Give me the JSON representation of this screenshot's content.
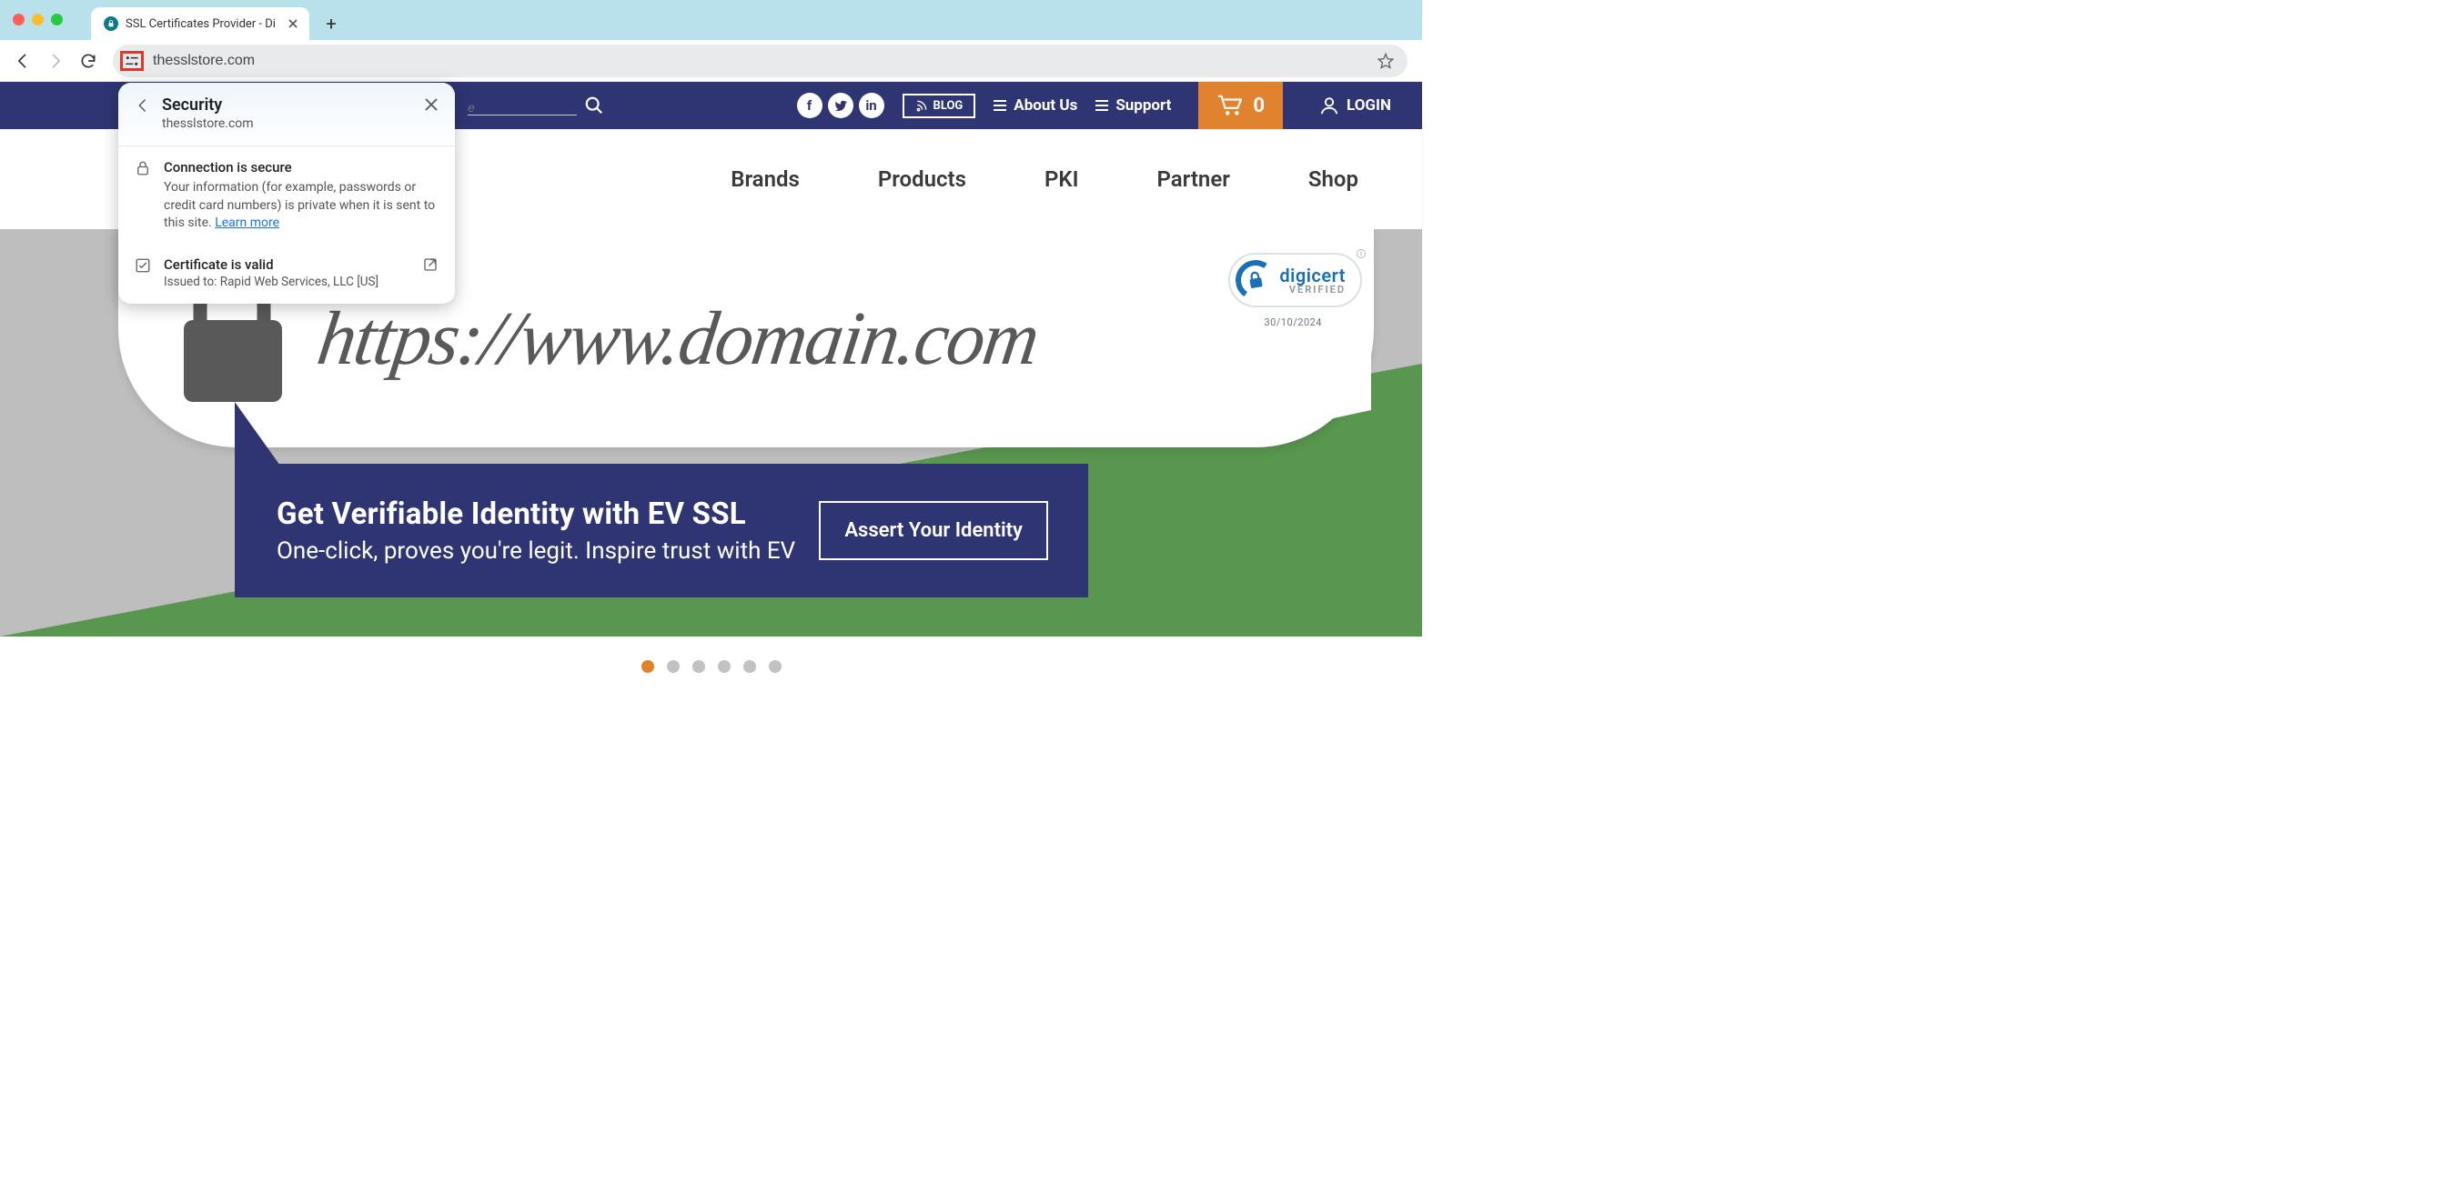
{
  "browser": {
    "tab_title": "SSL Certificates Provider - Di",
    "url": "thesslstore.com"
  },
  "popover": {
    "title": "Security",
    "domain": "thesslstore.com",
    "connection_heading": "Connection is secure",
    "connection_body": "Your information (for example, passwords or credit card numbers) is private when it is sent to this site. ",
    "learn_more": "Learn more",
    "cert_heading": "Certificate is valid",
    "cert_issued": "Issued to: Rapid Web Services, LLC [US]"
  },
  "site": {
    "search_placeholder": "e",
    "blog": "BLOG",
    "about": "About Us",
    "support": "Support",
    "cart_count": "0",
    "login": "LOGIN",
    "nav": {
      "brands": "Brands",
      "products": "Products",
      "pki": "PKI",
      "partner": "Partner",
      "shop": "Shop"
    },
    "hero": {
      "addr": "https://www.domain.com",
      "title": "Get Verifiable Identity with EV SSL",
      "sub": "One-click, proves you're legit. Inspire trust with EV",
      "cta": "Assert Your Identity"
    },
    "digicert": {
      "brand": "digicert",
      "verified": "VERIFIED",
      "date": "30/10/2024"
    },
    "carousel": {
      "count": 6,
      "active": 0
    }
  }
}
